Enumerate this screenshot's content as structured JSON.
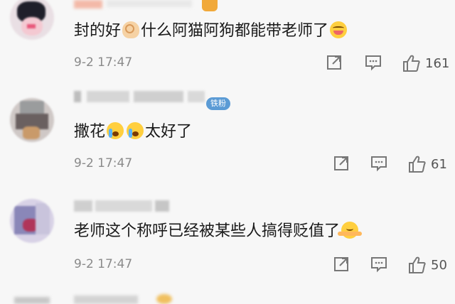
{
  "comments": [
    {
      "text_before": "封的好",
      "text_after": "什么阿猫阿狗都能带老师了",
      "emojis": [
        "ok-hand-emoji",
        "drooling-emoji"
      ],
      "time": "9-2 17:47",
      "likes": "161"
    },
    {
      "badge": "铁粉",
      "text_before": "撒花",
      "text_after": "太好了",
      "emojis": [
        "crying-laughing-emoji",
        "crying-laughing-emoji"
      ],
      "time": "9-2 17:47",
      "likes": "61"
    },
    {
      "text_before": "老师这个称呼已经被某些人搞得贬值了",
      "emojis": [
        "shrug-emoji"
      ],
      "time": "9-2 17:47",
      "likes": "50"
    }
  ],
  "icons": [
    "share-icon",
    "comment-icon",
    "like-icon"
  ],
  "colors": {
    "background": "#f7f7f7",
    "text": "#1a1a1a",
    "meta": "#8a8a8a",
    "badge": "#5b9bd5"
  }
}
